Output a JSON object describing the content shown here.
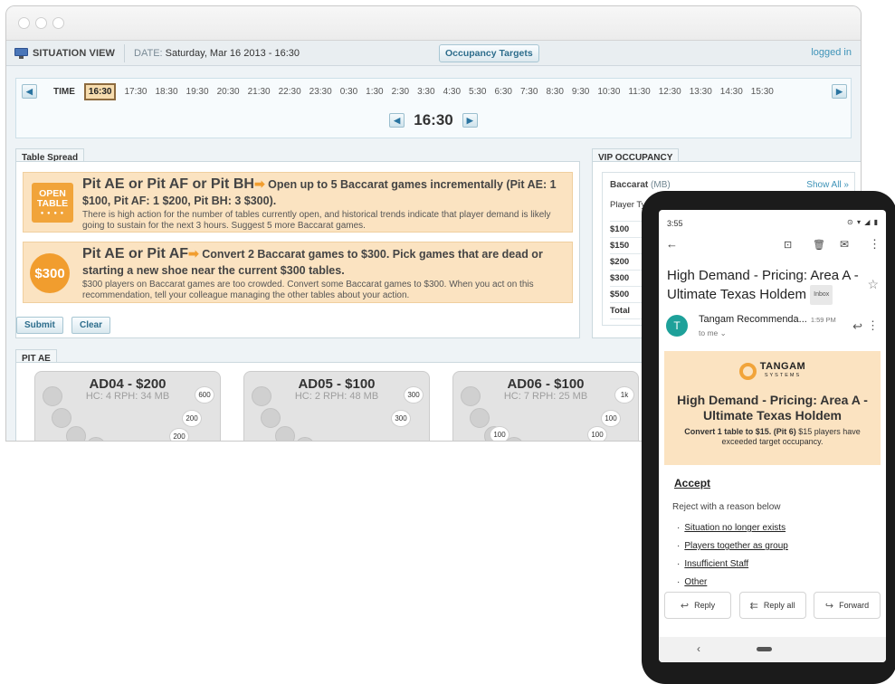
{
  "topbar": {
    "view_title": "SITUATION VIEW",
    "date_label": "DATE:",
    "date_value": "Saturday, Mar 16 2013 - 16:30",
    "occupancy_button": "Occupancy Targets",
    "login_status": "logged in"
  },
  "timeline": {
    "label": "TIME",
    "selected": "16:30",
    "times": [
      "16:30",
      "17:30",
      "18:30",
      "19:30",
      "20:30",
      "21:30",
      "22:30",
      "23:30",
      "0:30",
      "1:30",
      "2:30",
      "3:30",
      "4:30",
      "5:30",
      "6:30",
      "7:30",
      "8:30",
      "9:30",
      "10:30",
      "11:30",
      "12:30",
      "13:30",
      "14:30",
      "15:30"
    ],
    "current": "16:30",
    "prev_glyph": "◀",
    "next_glyph": "▶"
  },
  "spread": {
    "tab": "Table Spread",
    "rec1": {
      "badge_line1": "OPEN",
      "badge_line2": "TABLE",
      "badge_dots": "● ● ● ●",
      "title": "Pit AE or Pit AF or Pit BH",
      "arrow": "➡",
      "subtitle": " Open up to 5 Baccarat games incrementally (Pit AE: 1 $100, Pit AF: 1 $200, Pit BH: 3 $300).",
      "body": "There is high action for the number of tables currently open, and historical trends indicate that player demand is likely going to sustain for the next 3 hours. Suggest 5 more Baccarat games."
    },
    "rec2": {
      "badge": "$300",
      "title": "Pit AE or Pit AF",
      "arrow": "➡",
      "subtitle": " Convert 2 Baccarat games to $300. Pick games that are dead or starting a new shoe near the current $300 tables.",
      "body": "$300 players on Baccarat games are too crowded. Convert some Baccarat games to $300. When you act on this recommendation, tell your colleague managing the other tables about your action."
    },
    "submit": "Submit",
    "clear": "Clear"
  },
  "vip": {
    "tab": "VIP OCCUPANCY",
    "game": "Baccarat",
    "game_code": "(MB)",
    "show_all": "Show All »",
    "row_header": "Player Type",
    "rows": [
      "$100",
      "$150",
      "$200",
      "$300",
      "$500"
    ],
    "total": "Total"
  },
  "pit": {
    "tab": "PIT AE",
    "tables": [
      {
        "name": "AD04 - $200",
        "hc": "HC: 4",
        "rph": "RPH: 34",
        "type": "MB",
        "chips": [
          "600",
          "200",
          "200"
        ]
      },
      {
        "name": "AD05 - $100",
        "hc": "HC: 2",
        "rph": "RPH: 48",
        "type": "MB",
        "chips": [
          "300",
          "300"
        ]
      },
      {
        "name": "AD06 - $100",
        "hc": "HC: 7",
        "rph": "RPH: 25",
        "type": "MB",
        "chips": [
          "1k",
          "100",
          "100",
          "100"
        ]
      }
    ]
  },
  "phone": {
    "time": "3:55",
    "status_icons": "⊙ ▾ ◢ ▮",
    "subject": "High Demand - Pricing: Area A - Ultimate Texas Holdem",
    "label_chip": "Inbox",
    "sender_initial": "T",
    "sender": "Tangam Recommenda...",
    "sent_time": "1:59 PM",
    "recipient": "to me ⌄",
    "logo_name": "TANGAM",
    "logo_sub": "SYSTEMS",
    "banner_title": "High Demand - Pricing: Area A - Ultimate Texas Holdem",
    "banner_bold": "Convert 1 table to $15. (Pit 6)",
    "banner_rest": " $15 players have exceeded target occupancy.",
    "accept": "Accept",
    "reject_prompt": "Reject with a reason below",
    "reasons": [
      "Situation no longer exists",
      "Players together as group",
      "Insufficient Staff",
      "Other"
    ],
    "actions": {
      "reply": "Reply",
      "reply_all": "Reply all",
      "forward": "Forward"
    }
  }
}
